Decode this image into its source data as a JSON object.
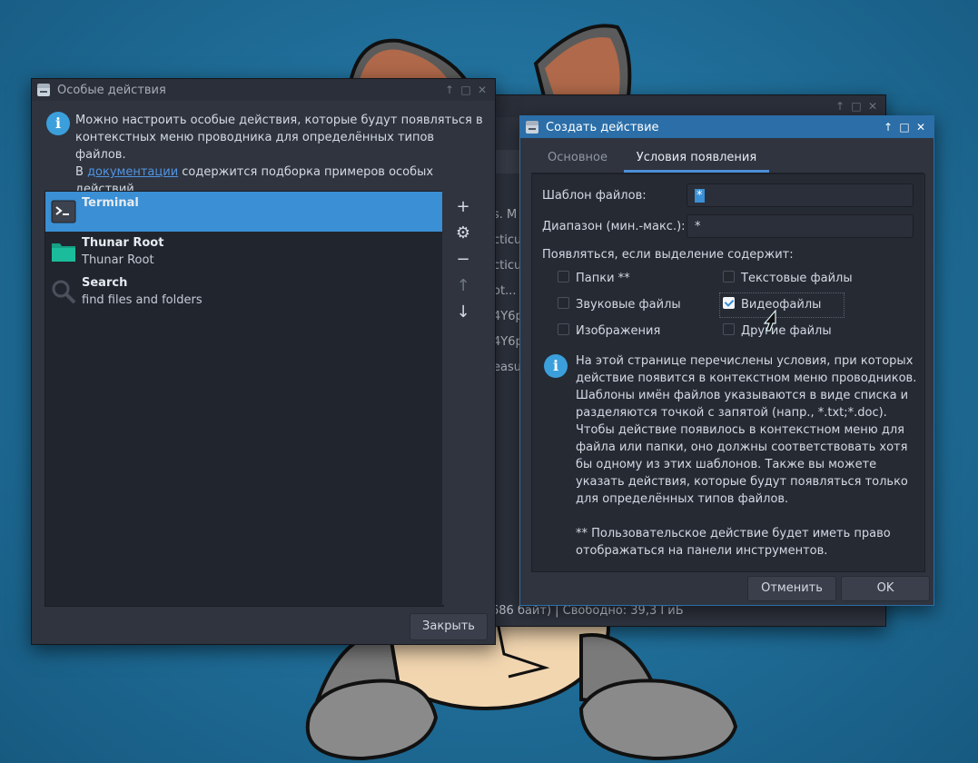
{
  "colors": {
    "accent": "#3b8fd4",
    "titlebar_active": "#2b6ea8",
    "window_bg": "#2f343f",
    "desktop": "#1f6d98"
  },
  "left_window": {
    "title": "Особые действия",
    "info_text": "Можно настроить особые действия, которые будут появляться в контекстных меню проводника для определённых типов файлов.",
    "doc_prefix": "В ",
    "doc_link": "документации",
    "doc_suffix": " содержится подборка примеров особых действий.",
    "actions": [
      {
        "name": "Terminal",
        "description": "",
        "icon": "terminal-icon",
        "selected": true
      },
      {
        "name": "Thunar Root",
        "description": "Thunar Root",
        "icon": "folder-icon",
        "selected": false
      },
      {
        "name": "Search",
        "description": "find files and folders",
        "icon": "search-icon",
        "selected": false
      }
    ],
    "side_buttons": [
      {
        "icon": "plus-icon",
        "glyph": "+"
      },
      {
        "icon": "gear-icon",
        "glyph": "⚙"
      },
      {
        "icon": "minus-icon",
        "glyph": "−"
      },
      {
        "icon": "arrow-up-icon",
        "glyph": "↑"
      },
      {
        "icon": "arrow-down-icon",
        "glyph": "↓"
      }
    ],
    "close_label": "Закрыть"
  },
  "middle_window": {
    "fragments": [
      "s. M",
      "cticu",
      "cticu",
      "ot... s",
      "4Y6p",
      "4Y6p",
      "easu"
    ],
    "status": "686 байт)  |  Свободно: 39,3 ГиБ"
  },
  "dialog": {
    "title": "Создать действие",
    "tabs": [
      "Основное",
      "Условия появления"
    ],
    "pattern_label": "Шаблон файлов:",
    "pattern_value": "*",
    "range_label": "Диапазон (мин.-макс.):",
    "range_value": "*",
    "appear_label": "Появляться, если выделение содержит:",
    "checkboxes": [
      {
        "label": "Папки **",
        "checked": false
      },
      {
        "label": "Текстовые файлы",
        "checked": false
      },
      {
        "label": "Звуковые файлы",
        "checked": false
      },
      {
        "label": "Видеофайлы",
        "checked": true
      },
      {
        "label": "Изображения",
        "checked": false
      },
      {
        "label": "Другие файлы",
        "checked": false
      }
    ],
    "help_text": "На этой странице перечислены условия, при которых действие появится в контекстном меню проводников. Шаблоны имён файлов указываются в виде списка и разделяются точкой с запятой (напр., *.txt;*.doc). Чтобы действие появилось в контекстном меню для файла или папки, оно должны соответствовать хотя бы одному из этих шаблонов. Также вы можете указать действия, которые будут появляться только для определённых типов файлов.\n\n** Пользовательское действие будет иметь право отображаться на панели инструментов.",
    "cancel_label": "Отменить",
    "ok_label": "OK"
  }
}
